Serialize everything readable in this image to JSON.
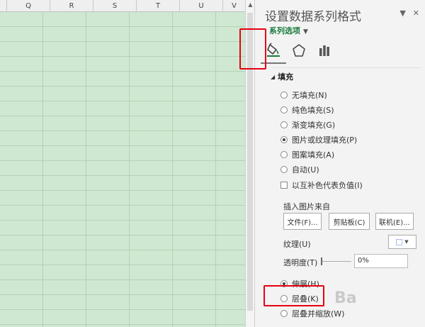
{
  "sheet": {
    "columns": [
      "Q",
      "R",
      "S",
      "T",
      "U",
      "V"
    ]
  },
  "pane": {
    "title": "设置数据系列格式",
    "series_options": "系列选项",
    "fill_section": "填充",
    "fill_options": [
      {
        "label": "无填充(N)",
        "selected": false
      },
      {
        "label": "纯色填充(S)",
        "selected": false
      },
      {
        "label": "渐变填充(G)",
        "selected": false
      },
      {
        "label": "图片或纹理填充(P)",
        "selected": true
      },
      {
        "label": "图案填充(A)",
        "selected": false
      },
      {
        "label": "自动(U)",
        "selected": false
      }
    ],
    "invert_label": "以互补色代表负值(I)",
    "insert_from": "插入图片来自",
    "buttons": {
      "file": "文件(F)...",
      "clipboard": "剪贴板(C)",
      "online": "联机(E)..."
    },
    "texture_label": "纹理(U)",
    "transparency_label": "透明度(T)",
    "transparency_value": "0%",
    "stack_options": [
      {
        "label": "伸展(H)",
        "selected": true
      },
      {
        "label": "层叠(K)",
        "selected": false
      },
      {
        "label": "层叠并缩放(W)",
        "selected": false
      }
    ],
    "controls": {
      "dropdown": "▼",
      "close": "✕"
    },
    "watermark": "Ba"
  },
  "colors": {
    "accent": "#1a7b3d",
    "highlight": "#e60012",
    "sheet_bg": "#cfe8d2"
  }
}
